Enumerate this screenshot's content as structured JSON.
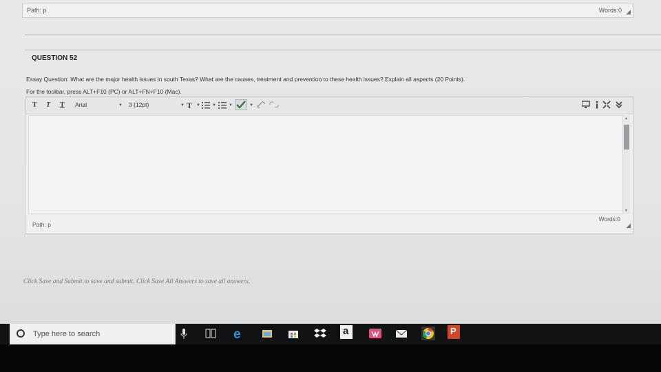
{
  "top_bar": {
    "path": "Path: p",
    "words": "Words:0"
  },
  "question": {
    "title": "QUESTION 52",
    "text": "Essay Question: What are the major health issues in south Texas? What are the causes, treatment and prevention to these health issues? Explain all aspects (20 Points).",
    "toolbar_hint": "For the toolbar, press ALT+F10 (PC) or ALT+FN+F10 (Mac)."
  },
  "toolbar": {
    "text_style_buttons": [
      "T",
      "T",
      "T"
    ],
    "font_family": "Arial",
    "font_size": "3 (12pt)"
  },
  "editor_footer": {
    "path": "Path: p",
    "words": "Words:0"
  },
  "instructions": "Click Save and Submit to save and submit. Click Save All Answers to save all answers.",
  "taskbar": {
    "search_placeholder": "Type here to search",
    "icons": [
      "microphone-icon",
      "task-view-icon",
      "edge-icon",
      "explorer-icon",
      "store-icon",
      "dropbox-icon",
      "amazon-icon",
      "office-icon",
      "mail-icon",
      "chrome-icon",
      "powerpoint-icon"
    ],
    "amazon_label": "a",
    "powerpoint_label": "P"
  },
  "colors": {
    "edge_blue": "#2f8fd8",
    "chrome_yellow": "#f4c20d",
    "powerpoint_orange": "#d24726",
    "office_pink": "#e34f7a"
  }
}
